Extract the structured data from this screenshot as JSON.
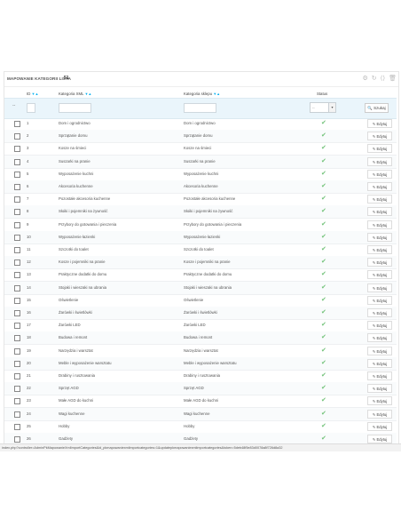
{
  "panel": {
    "title": "MAPOWANIE KATEGORII LISTA",
    "count": "51",
    "toolbar_icons": [
      "⚙",
      "↻",
      "⟨⟩",
      "🗑"
    ]
  },
  "columns": {
    "id": "ID",
    "xml": "Kategoria XML",
    "shop": "Kategoria sklepu",
    "status": "Status"
  },
  "sort_arrows": "▼▲",
  "filter": {
    "dash": "--",
    "select_value": "--",
    "search_label": "Szukaj"
  },
  "edit_label": "Edytuj",
  "status_check": "✔",
  "rows": [
    {
      "id": "1",
      "xml": "Dom i ogrodnictwo",
      "shop": "Dom i ogrodnictwo"
    },
    {
      "id": "2",
      "xml": "Sprzątanie domu",
      "shop": "Sprzątanie domu"
    },
    {
      "id": "3",
      "xml": "Kosze na śmieci",
      "shop": "Kosze na śmieci"
    },
    {
      "id": "4",
      "xml": "Suszarki na pranie",
      "shop": "Suszarki na pranie"
    },
    {
      "id": "5",
      "xml": "Wyposażenie kuchni",
      "shop": "Wyposażenie kuchni"
    },
    {
      "id": "6",
      "xml": "Akcesoria kuchenne",
      "shop": "Akcesoria kuchenne"
    },
    {
      "id": "7",
      "xml": "Pozostałe akcesoria kuchenne",
      "shop": "Pozostałe akcesoria kuchenne"
    },
    {
      "id": "8",
      "xml": "Słoiki i pojemniki na żywność",
      "shop": "Słoiki i pojemniki na żywność"
    },
    {
      "id": "9",
      "xml": "Przybory do gotowania i pieczenia",
      "shop": "Przybory do gotowania i pieczenia"
    },
    {
      "id": "10",
      "xml": "Wyposażenie łazienki",
      "shop": "Wyposażenie łazienki"
    },
    {
      "id": "11",
      "xml": "Szczotki do toalet",
      "shop": "Szczotki do toalet"
    },
    {
      "id": "12",
      "xml": "Kosze i pojemniki na pranie",
      "shop": "Kosze i pojemniki na pranie"
    },
    {
      "id": "13",
      "xml": "Praktyczne dodatki do domu",
      "shop": "Praktyczne dodatki do domu"
    },
    {
      "id": "14",
      "xml": "Stojaki i wieszaki na ubrania",
      "shop": "Stojaki i wieszaki na ubrania"
    },
    {
      "id": "15",
      "xml": "Oświetlenie",
      "shop": "Oświetlenie"
    },
    {
      "id": "16",
      "xml": "Żarówki i świetlówki",
      "shop": "Żarówki i świetlówki"
    },
    {
      "id": "17",
      "xml": "Żarówki LED",
      "shop": "Żarówki LED"
    },
    {
      "id": "18",
      "xml": "Budowa i remont",
      "shop": "Budowa i remont"
    },
    {
      "id": "19",
      "xml": "Narzędzia i warsztat",
      "shop": "Narzędzia i warsztat"
    },
    {
      "id": "20",
      "xml": "Meble i wyposażenie warsztatu",
      "shop": "Meble i wyposażenie warsztatu"
    },
    {
      "id": "21",
      "xml": "Drabiny i rusztowania",
      "shop": "Drabiny i rusztowania"
    },
    {
      "id": "22",
      "xml": "Sprzęt AGD",
      "shop": "Sprzęt AGD"
    },
    {
      "id": "23",
      "xml": "Małe AGD do kuchni",
      "shop": "Małe AGD do kuchni"
    },
    {
      "id": "24",
      "xml": "Wagi kuchenne",
      "shop": "Wagi kuchenne"
    },
    {
      "id": "25",
      "xml": "Hobby",
      "shop": "Hobby"
    },
    {
      "id": "26",
      "xml": "Gadżety",
      "shop": "Gadżety"
    }
  ],
  "statusbar": "index.php?controller=AdminPkMapowanieXmlImportCategories&id_pkmapowaniexmlimportcategories=1&updatepkmapowaniexmlimportcategories&token=5deb48f5e83d0078a8f726d8a32"
}
